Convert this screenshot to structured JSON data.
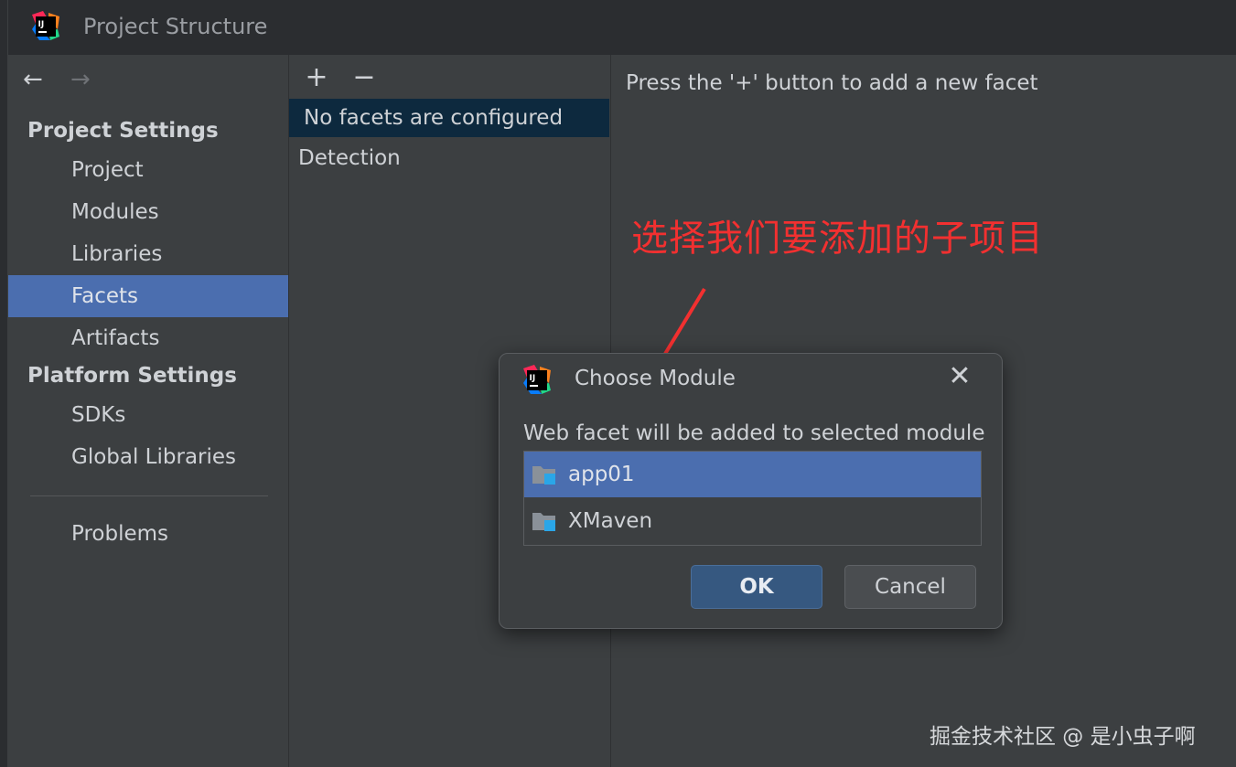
{
  "window": {
    "title": "Project Structure",
    "logo_icon": "intellij-idea-icon"
  },
  "nav": {
    "back_icon": "arrow-left-icon",
    "back_glyph": "←",
    "forward_icon": "arrow-right-icon",
    "forward_glyph": "→"
  },
  "sidebar": {
    "project_settings_title": "Project Settings",
    "project_items": [
      {
        "label": "Project",
        "selected": false
      },
      {
        "label": "Modules",
        "selected": false
      },
      {
        "label": "Libraries",
        "selected": false
      },
      {
        "label": "Facets",
        "selected": true
      },
      {
        "label": "Artifacts",
        "selected": false
      }
    ],
    "platform_settings_title": "Platform Settings",
    "platform_items": [
      {
        "label": "SDKs"
      },
      {
        "label": "Global Libraries"
      }
    ],
    "problems_label": "Problems"
  },
  "facets_panel": {
    "add_glyph": "+",
    "remove_glyph": "−",
    "empty_message": "No facets are configured",
    "detection_label": "Detection"
  },
  "details": {
    "hint": "Press the '+' button to add a new facet"
  },
  "annotation": {
    "text": "选择我们要添加的子项目",
    "color": "#f23030"
  },
  "dialog": {
    "title": "Choose Module",
    "close_glyph": "✕",
    "description": "Web facet will be added to selected module",
    "modules": [
      {
        "label": "app01",
        "selected": true
      },
      {
        "label": "XMaven",
        "selected": false
      }
    ],
    "ok_label": "OK",
    "cancel_label": "Cancel"
  },
  "watermark": "掘金技术社区 @ 是小虫子啊",
  "colors": {
    "selection": "#4b6eaf",
    "background": "#3c3f41",
    "title_bar": "#2b2d30"
  }
}
